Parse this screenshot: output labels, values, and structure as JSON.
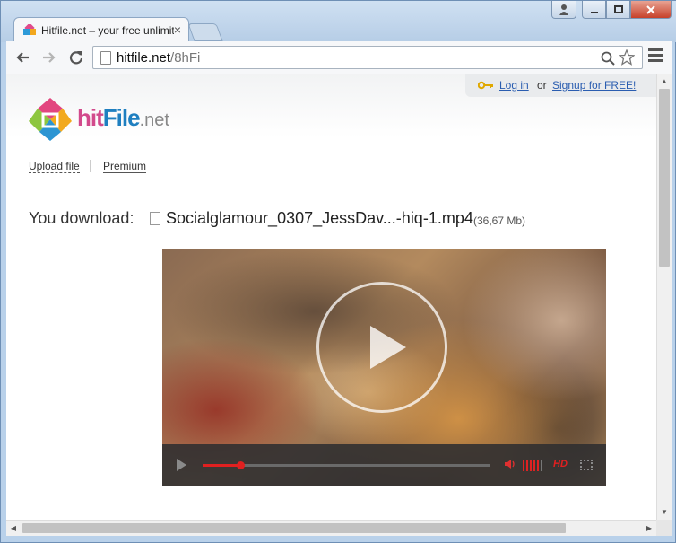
{
  "browser": {
    "tab_title": "Hitfile.net – your free unlimited",
    "tab_close": "×",
    "url_host": "hitfile.net",
    "url_path": "/8hFi"
  },
  "icons": {
    "back": "back-arrow-icon",
    "forward": "forward-arrow-icon",
    "reload": "reload-icon",
    "search": "search-icon",
    "star": "star-icon",
    "menu": "menu-icon",
    "key": "key-icon",
    "file": "file-icon",
    "play": "play-icon",
    "volume": "volume-icon",
    "fullscreen": "fullscreen-icon"
  },
  "header": {
    "login_label": "Log in",
    "or_label": "or",
    "signup_label": "Signup for FREE!",
    "logo_hit": "hit",
    "logo_file": "File",
    "logo_net": ".net"
  },
  "nav": {
    "upload_label": "Upload file",
    "premium_label": "Premium"
  },
  "download": {
    "label": "You download:",
    "file_name": "Socialglamour_0307_JessDav...-hiq-1.mp4",
    "file_size": "(36,67 Mb)"
  },
  "player": {
    "progress": 0.13,
    "volume_bars_on": 5,
    "volume_bars_total": 6,
    "hd_label": "HD"
  },
  "colors": {
    "accent_red": "#e02020",
    "link_blue": "#2a5db0",
    "logo_pink": "#d24a8c",
    "logo_blue": "#1f7fc0"
  }
}
